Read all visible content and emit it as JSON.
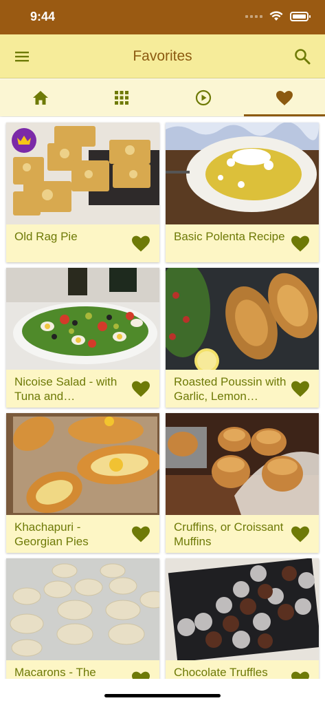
{
  "status_bar": {
    "time": "9:44"
  },
  "app_bar": {
    "title": "Favorites"
  },
  "tabs": [
    {
      "icon": "home-icon",
      "active": false
    },
    {
      "icon": "grid-icon",
      "active": false
    },
    {
      "icon": "play-circle-icon",
      "active": false
    },
    {
      "icon": "heart-icon",
      "active": true
    }
  ],
  "colors": {
    "status_bar": "#9a5a12",
    "app_bar": "#f6ec9a",
    "title": "#8c5a10",
    "accent_green": "#6e7a07",
    "card_bg": "#fdf6c5",
    "premium_badge": "#7b2aa8"
  },
  "recipes": [
    {
      "title": "Old Rag Pie",
      "premium": true
    },
    {
      "title": "Basic Polenta Recipe",
      "premium": false
    },
    {
      "title": "Nicoise Salad - with Tuna and…",
      "premium": false
    },
    {
      "title": "Roasted Poussin with Garlic, Lemon…",
      "premium": false
    },
    {
      "title": "Khachapuri - Georgian Pies",
      "premium": false
    },
    {
      "title": "Cruffins, or Croissant Muffins",
      "premium": false
    },
    {
      "title": "Macarons - The",
      "premium": false
    },
    {
      "title": "Chocolate Truffles",
      "premium": false
    }
  ]
}
